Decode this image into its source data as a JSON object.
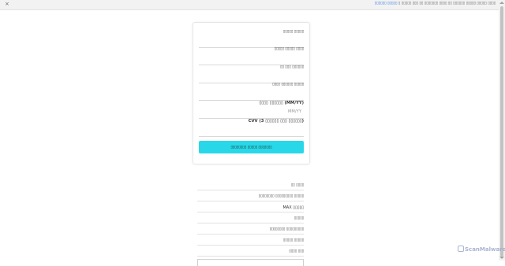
{
  "topbar": {
    "close_glyph": "×",
    "notice_prefix": "▯▯▯▯ ▯▯▯▯▯ ▯▯▯▯▯ ▯▯▯▯▯▯ ▯▯ ▯▯▯▯ ▯▯▯▯▯▯▯ ▯▯ ▯▯▯ ▯▯▯▯▯ ▯",
    "notice_link": "▯▯▯▯▯ ▯▯▯▯▯▯"
  },
  "form": {
    "name_label": "▯▯▯▯▯ ▯▯▯▯▯",
    "card_number_label": "▯▯▯▯ ▯▯▯▯▯ ▯▯▯▯▯",
    "phone_label": "▯▯▯▯▯▯ ▯▯▯ ▯▯",
    "id_label": "▯▯▯▯▯ ▯▯▯▯▯▯ ▯▯▯▯",
    "expiry_label": "(MM/YY) ▯▯▯▯▯▯ ▯▯▯▯",
    "expiry_placeholder": "MM/YY",
    "cvv_label": "(▯▯▯▯▯▯ ▯▯▯ ▯▯▯▯▯▯ 3) CVV",
    "submit_label": "▯▯▯▯▯▯▯ ▯▯▯▯▯ ▯▯▯▯▯▯▯▯"
  },
  "footer": {
    "items": [
      "▯▯▯▯ ▯▯",
      "▯▯▯▯▯ ▯▯▯▯▯▯▯▯▯ ▯▯▯▯▯▯▯▯",
      "▯▯▯▯▯ MAX",
      "▯▯▯▯▯",
      "▯▯▯▯▯▯▯▯▯ ▯▯▯▯▯▯▯▯",
      "▯▯▯▯▯ ▯▯▯▯▯",
      "▯▯▯ ▯▯▯▯"
    ]
  },
  "watermark": {
    "text": "ScanMalware"
  },
  "colors": {
    "button": "#28d8e8",
    "link": "#2a6fdb"
  }
}
